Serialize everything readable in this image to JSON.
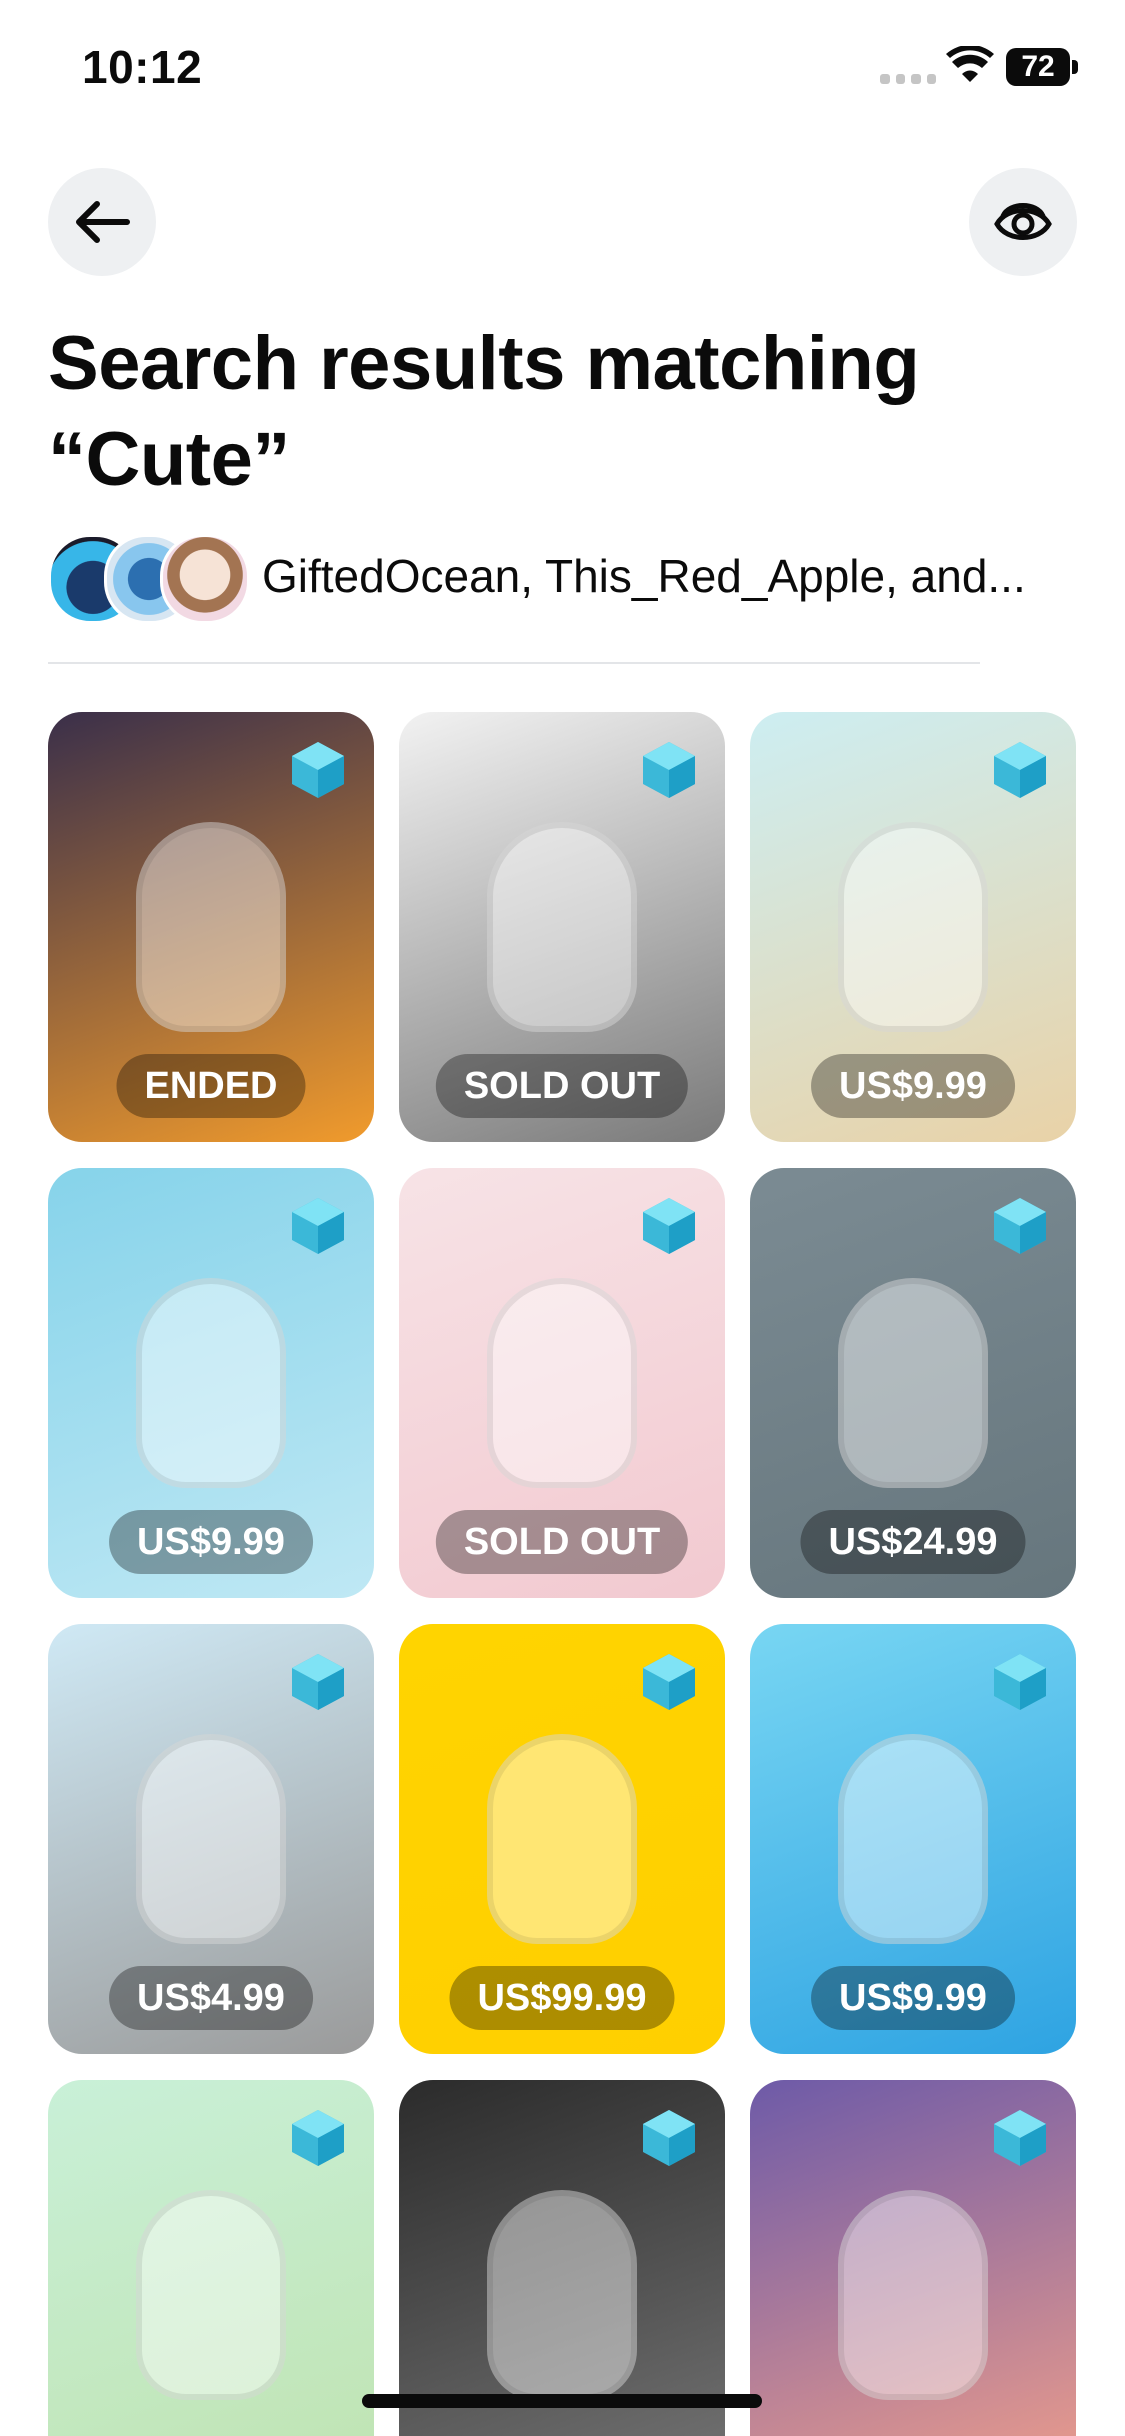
{
  "status_bar": {
    "time": "10:12",
    "battery": "72"
  },
  "header": {
    "back_icon": "arrow-left-icon",
    "visibility_icon": "eye-icon"
  },
  "title": "Search results matching “Cute”",
  "creators": {
    "text": "GiftedOcean, This_Red_Apple, and..."
  },
  "results": [
    {
      "label": "ENDED",
      "colors": [
        "#3a2f4a",
        "#f19b2c"
      ]
    },
    {
      "label": "SOLD OUT",
      "colors": [
        "#f2f2f2",
        "#7a7a7a"
      ]
    },
    {
      "label": "US$9.99",
      "colors": [
        "#cdeef2",
        "#e9d2a7"
      ]
    },
    {
      "label": "US$9.99",
      "colors": [
        "#86d3ea",
        "#bfe8f4"
      ]
    },
    {
      "label": "SOLD OUT",
      "colors": [
        "#f7e3e6",
        "#f2c9d0"
      ]
    },
    {
      "label": "US$24.99",
      "colors": [
        "#7b8b93",
        "#66767d"
      ]
    },
    {
      "label": "US$4.99",
      "colors": [
        "#cfe9f5",
        "#9a9a9a"
      ]
    },
    {
      "label": "US$99.99",
      "colors": [
        "#ffd400",
        "#ffcf00"
      ]
    },
    {
      "label": "US$9.99",
      "colors": [
        "#78d6f3",
        "#2ea3e2"
      ]
    },
    {
      "label": "",
      "colors": [
        "#c9f0d8",
        "#bfe3b0"
      ]
    },
    {
      "label": "",
      "colors": [
        "#2b2b2b",
        "#777777"
      ]
    },
    {
      "label": "",
      "colors": [
        "#6d5aa8",
        "#f3a08a"
      ]
    }
  ],
  "accent_colors": {
    "badge": "#3bb8d8",
    "pill": "rgba(0,0,0,0.32)"
  }
}
